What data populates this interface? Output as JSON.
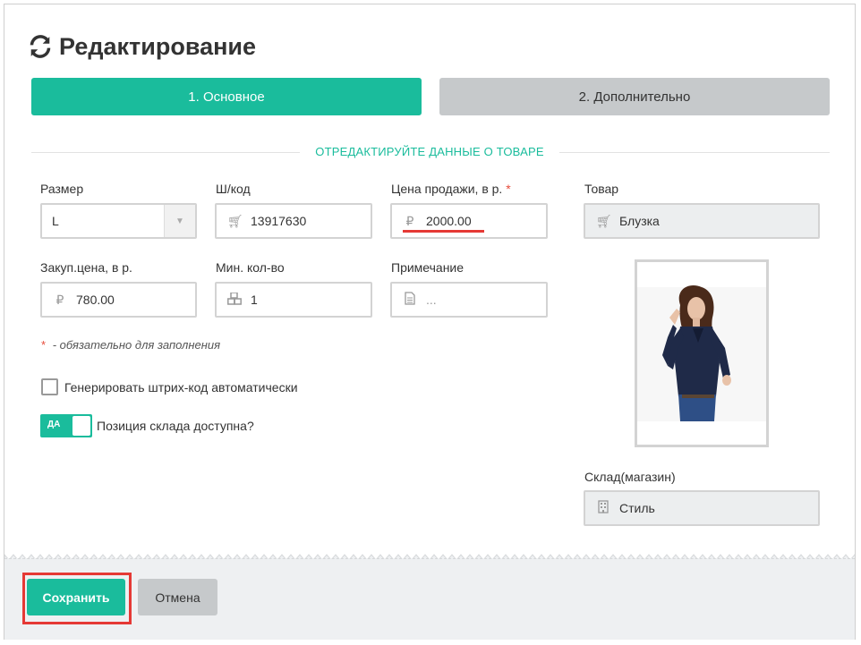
{
  "header": {
    "title": "Редактирование",
    "icon": "refresh-icon"
  },
  "tabs": [
    {
      "label": "1. Основное",
      "active": true
    },
    {
      "label": "2. Дополнительно",
      "active": false
    }
  ],
  "section_label": "ОТРЕДАКТИРУЙТЕ ДАННЫЕ О ТОВАРЕ",
  "fields": {
    "size": {
      "label": "Размер",
      "value": "L"
    },
    "barcode": {
      "label": "Ш/код",
      "value": "13917630",
      "icon": "cart-icon"
    },
    "sale_price": {
      "label": "Цена продажи, в р.",
      "required_mark": "*",
      "value": "2000.00",
      "icon": "ruble-icon"
    },
    "product": {
      "label": "Товар",
      "value": "Блузка",
      "icon": "cart-icon"
    },
    "purchase_price": {
      "label": "Закуп.цена, в р.",
      "value": "780.00",
      "icon": "ruble-icon"
    },
    "min_qty": {
      "label": "Мин. кол-во",
      "value": "1",
      "icon": "cubes-icon"
    },
    "note": {
      "label": "Примечание",
      "placeholder": "...",
      "icon": "document-icon"
    },
    "store": {
      "label": "Склад(магазин)",
      "value": "Стиль",
      "icon": "building-icon"
    }
  },
  "required_note": {
    "mark": "*",
    "text": "- обязательно для заполнения"
  },
  "generate_barcode": {
    "label": "Генерировать штрих-код автоматически",
    "checked": false
  },
  "available_toggle": {
    "state_label": "ДА",
    "label": "Позиция склада доступна?",
    "on": true
  },
  "buttons": {
    "save": "Сохранить",
    "cancel": "Отмена"
  },
  "colors": {
    "accent": "#1abc9c",
    "secondary": "#c6c9cb",
    "highlight": "#e53935"
  }
}
